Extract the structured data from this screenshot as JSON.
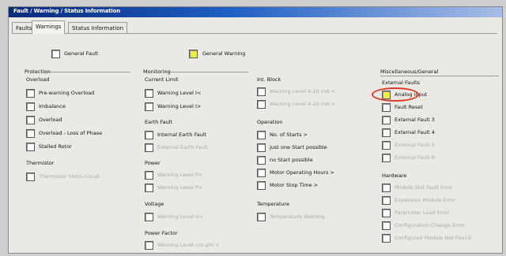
{
  "window": {
    "title": "Fault / Warning / Status Information"
  },
  "tabs": [
    {
      "label": "Faults",
      "active": false
    },
    {
      "label": "Warnings",
      "active": true
    },
    {
      "label": "Status Information",
      "active": false
    }
  ],
  "general": {
    "general_fault": "General Fault",
    "general_warning": "General Warning"
  },
  "protection": {
    "title": "Protection",
    "overload_label": "Overload",
    "items": [
      "Pre-warning Overload",
      "Imbalance",
      "Overload",
      "Overload - Loss of Phase",
      "Stalled Rotor"
    ],
    "thermistor_label": "Thermistor",
    "thermistor_item": "Thermistor Short-circuit"
  },
  "monitoring": {
    "title": "Monitoring",
    "current_limit_label": "Current Limit",
    "current_items": [
      "Warning Level I<",
      "Warning Level I>"
    ],
    "earth_fault_label": "Earth Fault",
    "earth_items": [
      "Internal Earth Fault",
      "External Earth Fault"
    ],
    "power_label": "Power",
    "power_items": [
      "Warning Level P<",
      "Warning Level P>"
    ],
    "voltage_label": "Voltage",
    "voltage_item": "Warning Level U<",
    "power_factor_label": "Power Factor",
    "power_factor_item": "Warning Level cos phi <"
  },
  "ia_block": {
    "title": "Int. Block",
    "items": [
      "Warning Level 4-20 mA <",
      "Warning Level 4-20 mA >"
    ]
  },
  "operation": {
    "title": "Operation",
    "items": [
      "No. of Starts >",
      "just one Start possible",
      "no Start possible",
      "Motor Operating Hours >",
      "Motor Stop Time >"
    ]
  },
  "temperature": {
    "title": "Temperature",
    "item": "Temperature Warning"
  },
  "misc": {
    "title": "Miscellaneous/General",
    "external_faults_label": "External Faults",
    "external_items": [
      "Analog input",
      "Fault Reset",
      "External Fault 3",
      "External Fault 4",
      "External Fault 5",
      "External Fault 6"
    ],
    "hardware_label": "Hardware",
    "hardware_items": [
      "Module Slot Fault Error",
      "Expansion Module Error",
      "Parameter Load Error",
      "Configuration Change Error",
      "Configured Module Not Found"
    ]
  }
}
